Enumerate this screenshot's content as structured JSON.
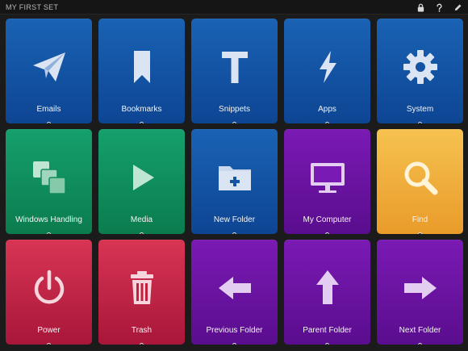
{
  "header": {
    "set_title": "MY FIRST SET",
    "icons": [
      "lock-icon",
      "help-icon",
      "edit-pencil-icon"
    ]
  },
  "colors": {
    "background": "#1b1b1b",
    "blue": "#1a62b4",
    "green": "#15a06c",
    "purple": "#7a1ab4",
    "yellow": "#f6c24f",
    "red": "#d83553"
  },
  "tiles": [
    {
      "label": "Emails",
      "icon": "paper-plane-icon",
      "color": "blue"
    },
    {
      "label": "Bookmarks",
      "icon": "bookmark-icon",
      "color": "blue"
    },
    {
      "label": "Snippets",
      "icon": "text-t-icon",
      "color": "blue"
    },
    {
      "label": "Apps",
      "icon": "lightning-bolt-icon",
      "color": "blue"
    },
    {
      "label": "System",
      "icon": "gear-icon",
      "color": "blue"
    },
    {
      "label": "Windows Handling",
      "icon": "stacked-windows-icon",
      "color": "green"
    },
    {
      "label": "Media",
      "icon": "play-icon",
      "color": "green"
    },
    {
      "label": "New Folder",
      "icon": "folder-plus-icon",
      "color": "blue"
    },
    {
      "label": "My Computer",
      "icon": "monitor-icon",
      "color": "purple"
    },
    {
      "label": "Find",
      "icon": "magnifier-icon",
      "color": "yellow"
    },
    {
      "label": "Power",
      "icon": "power-icon",
      "color": "red"
    },
    {
      "label": "Trash",
      "icon": "trash-icon",
      "color": "red"
    },
    {
      "label": "Previous Folder",
      "icon": "arrow-left-icon",
      "color": "purple"
    },
    {
      "label": "Parent Folder",
      "icon": "arrow-up-icon",
      "color": "purple"
    },
    {
      "label": "Next Folder",
      "icon": "arrow-right-icon",
      "color": "purple"
    }
  ]
}
